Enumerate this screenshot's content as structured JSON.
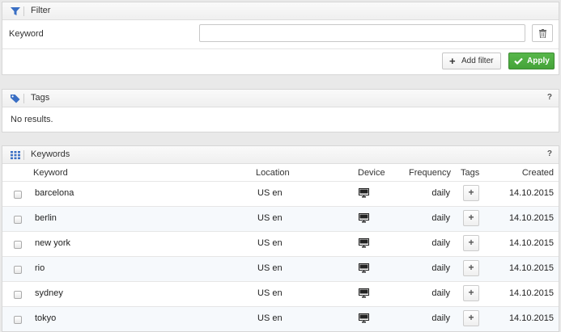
{
  "filter": {
    "title": "Filter",
    "keyword_label": "Keyword",
    "keyword_value": "",
    "keyword_placeholder": "",
    "add_filter_label": "Add filter",
    "apply_label": "Apply"
  },
  "tags": {
    "title": "Tags",
    "help": "?",
    "empty_text": "No results."
  },
  "keywords": {
    "title": "Keywords",
    "help": "?",
    "columns": {
      "keyword": "Keyword",
      "location": "Location",
      "device": "Device",
      "frequency": "Frequency",
      "tags": "Tags",
      "created": "Created"
    },
    "rows": [
      {
        "keyword": "barcelona",
        "location": "US en",
        "device": "desktop-icon",
        "frequency": "daily",
        "tag_button": "+",
        "created": "14.10.2015"
      },
      {
        "keyword": "berlin",
        "location": "US en",
        "device": "desktop-icon",
        "frequency": "daily",
        "tag_button": "+",
        "created": "14.10.2015"
      },
      {
        "keyword": "new york",
        "location": "US en",
        "device": "desktop-icon",
        "frequency": "daily",
        "tag_button": "+",
        "created": "14.10.2015"
      },
      {
        "keyword": "rio",
        "location": "US en",
        "device": "desktop-icon",
        "frequency": "daily",
        "tag_button": "+",
        "created": "14.10.2015"
      },
      {
        "keyword": "sydney",
        "location": "US en",
        "device": "desktop-icon",
        "frequency": "daily",
        "tag_button": "+",
        "created": "14.10.2015"
      },
      {
        "keyword": "tokyo",
        "location": "US en",
        "device": "desktop-icon",
        "frequency": "daily",
        "tag_button": "+",
        "created": "14.10.2015"
      }
    ]
  },
  "colors": {
    "accent_blue": "#3a6fc4",
    "apply_green": "#45a339"
  }
}
